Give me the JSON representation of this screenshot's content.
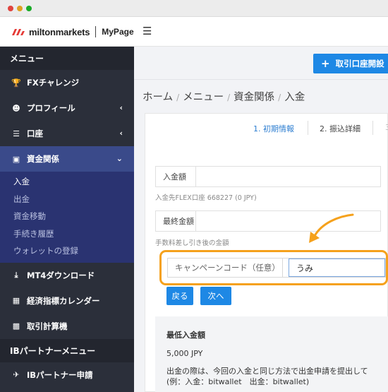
{
  "header": {
    "logo_text": "miltonmarkets",
    "logo_page": "MyPage",
    "menu_icon": "hamburger-icon"
  },
  "sidebar": {
    "title": "メニュー",
    "items": [
      {
        "label": "FXチャレンジ",
        "icon": "trophy-icon"
      },
      {
        "label": "プロフィール",
        "icon": "user-icon"
      },
      {
        "label": "口座",
        "icon": "list-icon"
      },
      {
        "label": "資金関係",
        "icon": "wallet-icon"
      }
    ],
    "sub_items": [
      "入金",
      "出金",
      "資金移動",
      "手続き履歴",
      "ウォレットの登録"
    ],
    "items_after": [
      {
        "label": "MT4ダウンロード",
        "icon": "download-icon"
      },
      {
        "label": "経済指標カレンダー",
        "icon": "calendar-icon"
      },
      {
        "label": "取引計算機",
        "icon": "calculator-icon"
      }
    ],
    "section2_title": "IBパートナーメニュー",
    "ib_item": {
      "label": "IBパートナー申請",
      "icon": "handshake-icon"
    }
  },
  "main": {
    "open_account_button": "取引口座開設",
    "breadcrumb": [
      "ホーム",
      "メニュー",
      "資金関係",
      "入金"
    ],
    "steps": [
      "1. 初期情報",
      "2. 振込詳細",
      "3"
    ],
    "deposit_amount_label": "入金額",
    "deposit_hint": "入金先FLEX口座 668227 (0 JPY)",
    "final_amount_label": "最終金額",
    "final_hint": "手数料差し引き後の金額",
    "campaign_label": "キャンペーンコード（任意）",
    "campaign_value": "うみ",
    "back_button": "戻る",
    "next_button": "次へ",
    "info_title": "最低入金額",
    "info_min": "5,000 JPY",
    "info_text1": "出金の際は、今回の入金と同じ方法で出金申請を提出して",
    "info_text2": "(例：入金：bitwallet　出金：bitwallet)"
  },
  "colors": {
    "accent_blue": "#1e88e5",
    "highlight_orange": "#f5a11c",
    "sidebar_bg": "#2b2f3a",
    "sidebar_active": "#2a3371"
  }
}
